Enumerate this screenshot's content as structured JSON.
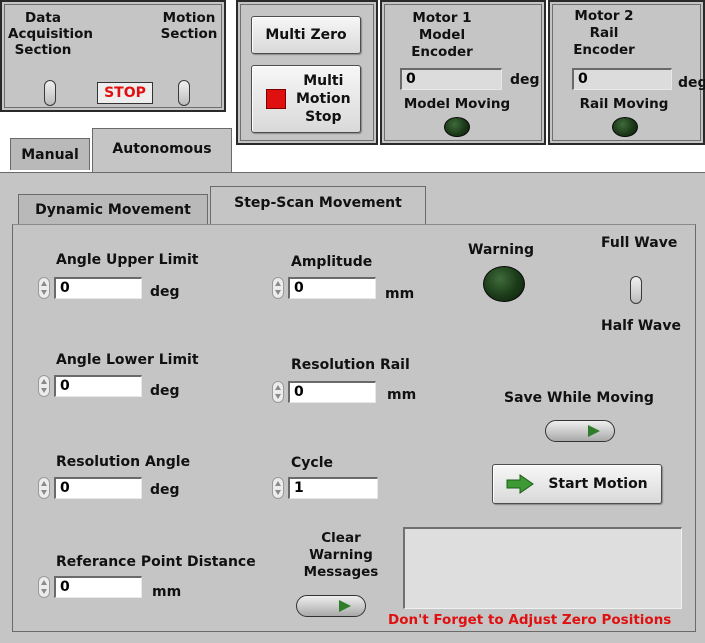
{
  "sections": {
    "data_acquisition": "Data\nAcquisition\nSection",
    "motion": "Motion\nSection",
    "stop": "STOP"
  },
  "buttons": {
    "multi_zero": "Multi Zero",
    "multi_motion_stop": "Multi\nMotion\nStop",
    "start_motion": "Start Motion",
    "save_while_moving": "Save While Moving",
    "clear_warning": "Clear\nWarning\nMessages"
  },
  "motor1": {
    "title": "Motor 1\nModel\nEncoder",
    "value": "0",
    "unit": "deg",
    "status": "Model Moving"
  },
  "motor2": {
    "title": "Motor 2\nRail\nEncoder",
    "value": "0",
    "unit": "deg",
    "status": "Rail Moving"
  },
  "tabs_top": [
    "Manual",
    "Autonomous"
  ],
  "tabs_sub": [
    "Dynamic Movement",
    "Step-Scan Movement"
  ],
  "fields": {
    "angle_upper": {
      "label": "Angle Upper Limit",
      "value": "0",
      "unit": "deg"
    },
    "angle_lower": {
      "label": "Angle Lower Limit",
      "value": "0",
      "unit": "deg"
    },
    "resolution_angle": {
      "label": "Resolution Angle",
      "value": "0",
      "unit": "deg"
    },
    "reference_distance": {
      "label": "Referance Point Distance",
      "value": "0",
      "unit": "mm"
    },
    "amplitude": {
      "label": "Amplitude",
      "value": "0",
      "unit": "mm"
    },
    "resolution_rail": {
      "label": "Resolution Rail",
      "value": "0",
      "unit": "mm"
    },
    "cycle": {
      "label": "Cycle",
      "value": "1"
    }
  },
  "warning": "Warning",
  "wave": {
    "full": "Full Wave",
    "half": "Half Wave"
  },
  "message_text": "Don't Forget to Adjust Zero Positions",
  "colors": {
    "panel": "#c5c5c5",
    "led_off": "#1b3a18",
    "stop_red": "#e01010",
    "warning_text": "#e01010",
    "arrow_green": "#2f7d2a"
  },
  "icons": {
    "led": "indicator-led-icon",
    "arrow": "right-arrow-icon",
    "stop_square": "red-square-icon"
  }
}
